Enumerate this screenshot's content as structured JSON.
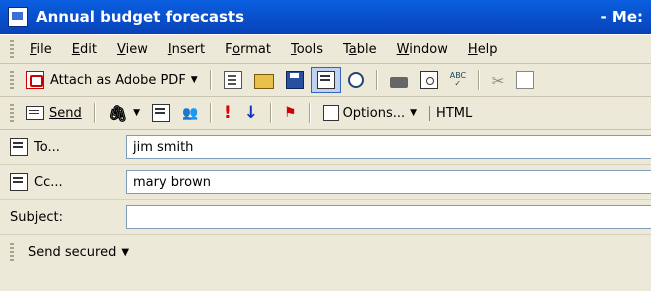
{
  "window": {
    "title": "Annual budget forecasts",
    "title_suffix": "- Me:"
  },
  "menu": [
    {
      "label": "File",
      "key": "F",
      "rest": "ile"
    },
    {
      "label": "Edit",
      "key": "E",
      "rest": "dit"
    },
    {
      "label": "View",
      "key": "V",
      "rest": "iew"
    },
    {
      "label": "Insert",
      "key": "I",
      "rest": "nsert"
    },
    {
      "label": "Format",
      "key": "o",
      "pre": "F",
      "rest": "rmat"
    },
    {
      "label": "Tools",
      "key": "T",
      "rest": "ools"
    },
    {
      "label": "Table",
      "key": "a",
      "pre": "T",
      "rest": "ble"
    },
    {
      "label": "Window",
      "key": "W",
      "rest": "indow"
    },
    {
      "label": "Help",
      "key": "H",
      "rest": "elp"
    }
  ],
  "toolbar1": {
    "attach_pdf": "Attach as Adobe PDF",
    "icons": [
      "properties-icon",
      "open-folder-icon",
      "save-icon",
      "address-book-icon",
      "research-icon",
      "print-icon",
      "print-preview-icon",
      "spelling-icon",
      "cut-icon",
      "copy-icon"
    ]
  },
  "toolbar2": {
    "send": "Send",
    "options": "Options...",
    "format": "HTML"
  },
  "fields": {
    "to_label": "To...",
    "to_value": "jim smith",
    "cc_label": "Cc...",
    "cc_value": "mary brown",
    "subject_label": "Subject:",
    "subject_value": ""
  },
  "footer": {
    "send_secured": "Send secured"
  },
  "colors": {
    "title_bar": "#0A5FE0",
    "chrome": "#ECE9D8",
    "high_importance": "#d00",
    "low_importance": "#1234c8"
  }
}
